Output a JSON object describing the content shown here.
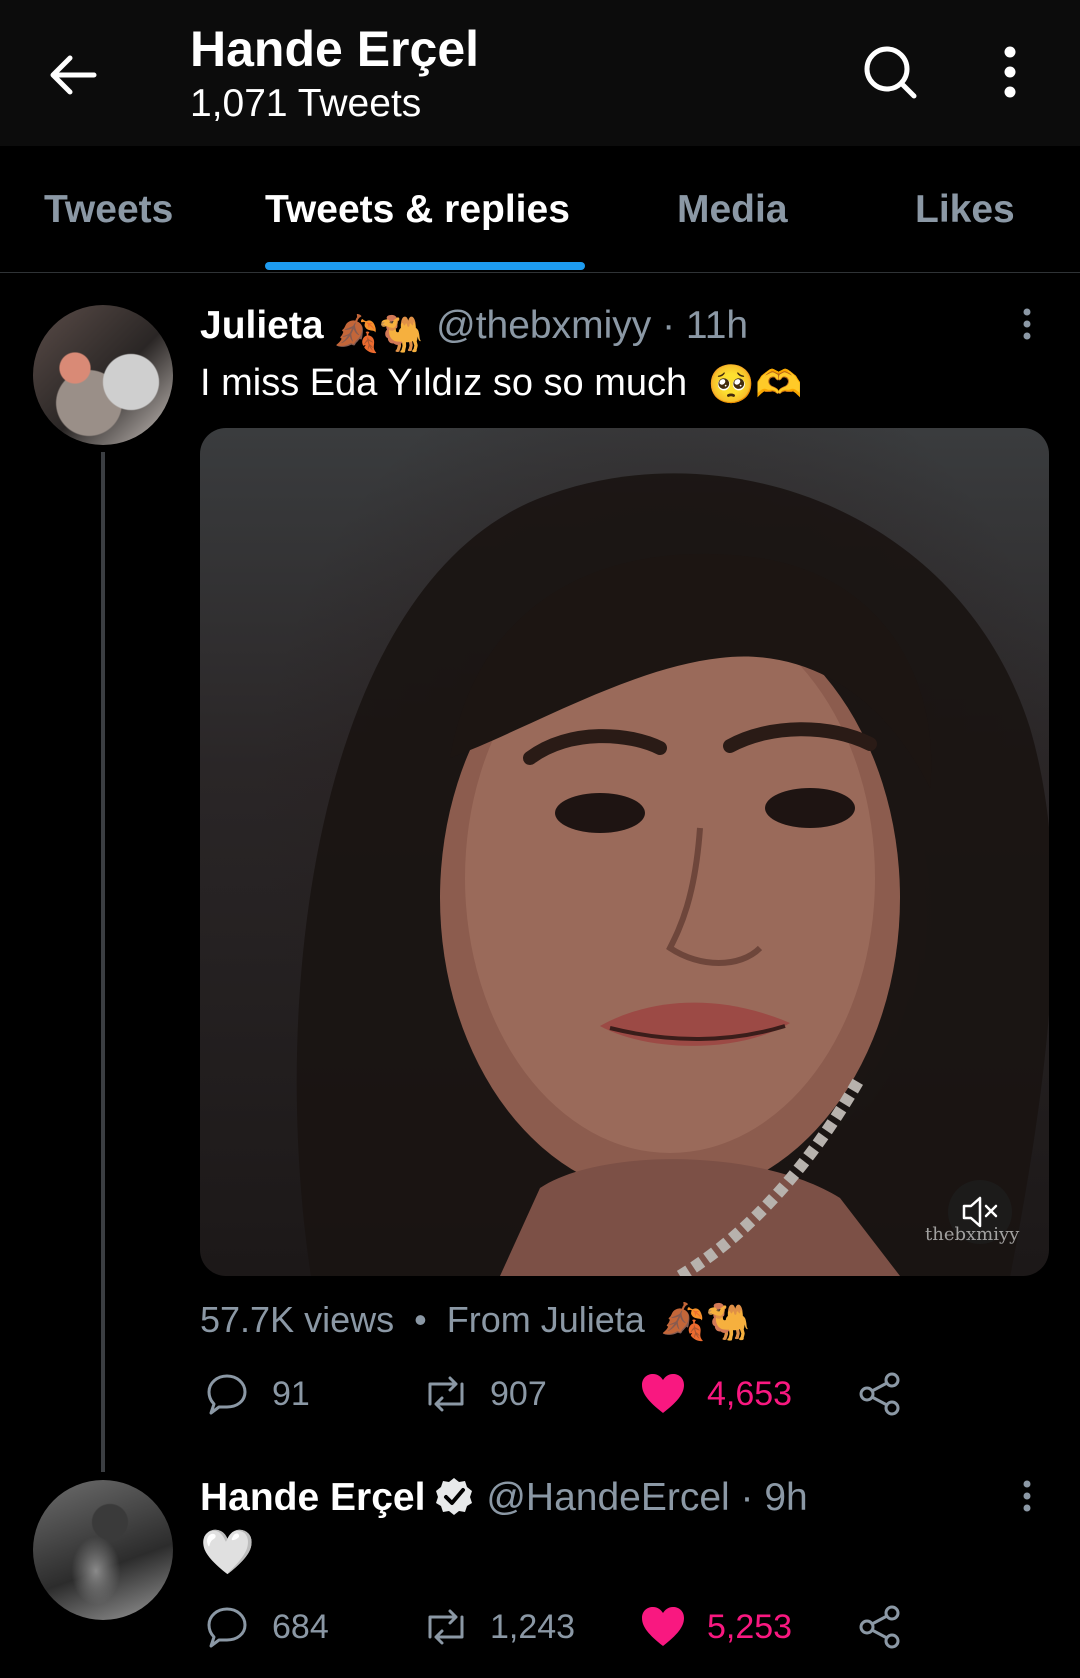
{
  "header": {
    "title": "Hande Erçel",
    "subtitle": "1,071 Tweets"
  },
  "tabs": [
    {
      "label": "Tweets"
    },
    {
      "label": "Tweets & replies"
    },
    {
      "label": "Media"
    },
    {
      "label": "Likes"
    }
  ],
  "active_tab": "Tweets & replies",
  "colors": {
    "accent": "#1d9bf0",
    "like": "#f91880",
    "secondary_text": "#8b98a5",
    "background": "#000000"
  },
  "tweet1": {
    "name": "Julieta",
    "name_emoji": "🍂🐫",
    "handle": "@thebxmiyy · 11h",
    "text": "I miss Eda Yıldız so so much",
    "text_emoji": "🥺🫶",
    "media_watermark": "thebxmiyy",
    "views": "57.7K views",
    "source": "From Julieta",
    "source_emoji": "🍂🐫",
    "replies": "91",
    "retweets": "907",
    "likes": "4,653"
  },
  "tweet2": {
    "name": "Hande Erçel",
    "handle": "@HandeErcel · 9h",
    "text": "🤍",
    "replies": "684",
    "retweets": "1,243",
    "likes": "5,253"
  }
}
